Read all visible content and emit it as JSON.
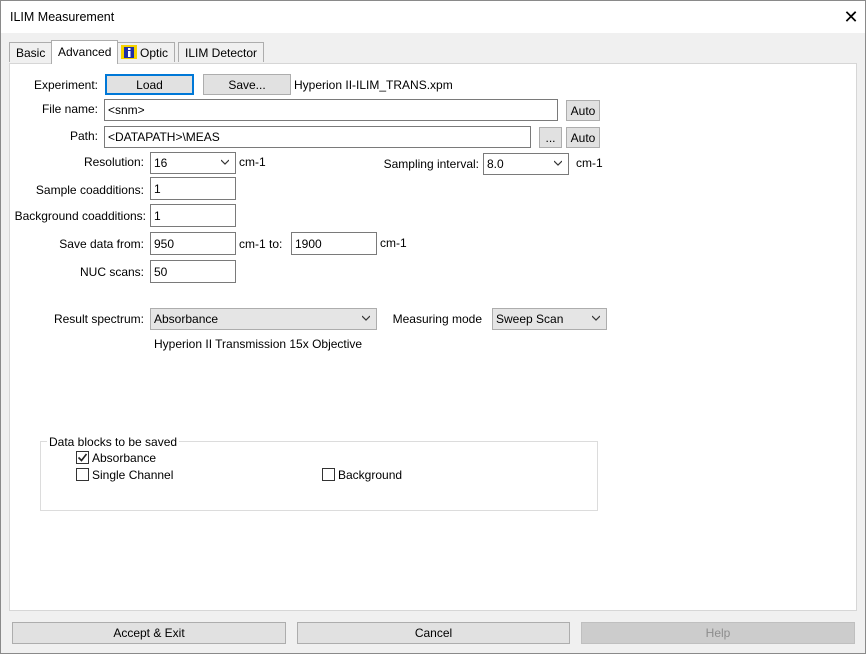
{
  "window": {
    "title": "ILIM Measurement"
  },
  "tabs": [
    {
      "label": "Basic"
    },
    {
      "label": "Advanced"
    },
    {
      "label": "Optic",
      "icon": "info-icon"
    },
    {
      "label": "ILIM Detector"
    }
  ],
  "experiment": {
    "label": "Experiment:",
    "load_label": "Load",
    "save_label": "Save...",
    "file": "Hyperion II-ILIM_TRANS.xpm"
  },
  "file_name": {
    "label": "File name:",
    "value": "<snm>",
    "auto_label": "Auto"
  },
  "path": {
    "label": "Path:",
    "value": "<DATAPATH>\\MEAS",
    "browse_label": "...",
    "auto_label": "Auto"
  },
  "resolution": {
    "label": "Resolution:",
    "value": "16",
    "unit": "cm-1"
  },
  "sampling": {
    "label": "Sampling interval:",
    "value": "8.0",
    "unit": "cm-1"
  },
  "sample_coadditions": {
    "label": "Sample coadditions:",
    "value": "1"
  },
  "background_coadditions": {
    "label": "Background coadditions:",
    "value": "1"
  },
  "save_data": {
    "label": "Save data from:",
    "from": "950",
    "mid_label": "cm-1 to:",
    "to": "1900",
    "unit": "cm-1"
  },
  "nuc_scans": {
    "label": "NUC scans:",
    "value": "50"
  },
  "result_spectrum": {
    "label": "Result spectrum:",
    "value": "Absorbance",
    "note": "Hyperion II Transmission 15x Objective"
  },
  "measuring_mode": {
    "label": "Measuring mode",
    "value": "Sweep Scan"
  },
  "data_blocks": {
    "title": "Data blocks to be saved",
    "absorbance": {
      "label": "Absorbance",
      "checked": true
    },
    "single_channel": {
      "label": "Single Channel",
      "checked": false
    },
    "background": {
      "label": "Background",
      "checked": false
    }
  },
  "footer": {
    "accept_label": "Accept & Exit",
    "cancel_label": "Cancel",
    "help_label": "Help"
  }
}
